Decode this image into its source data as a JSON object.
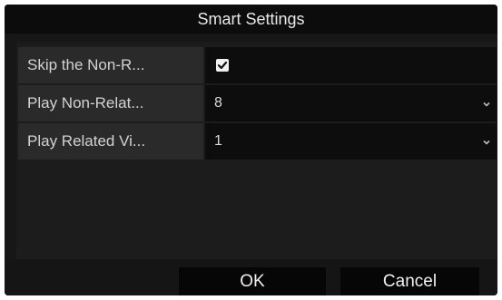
{
  "dialog": {
    "title": "Smart Settings"
  },
  "settings": [
    {
      "label": "Skip the Non-R...",
      "control": "checkbox",
      "checked": true
    },
    {
      "label": "Play Non-Relat...",
      "control": "select",
      "value": "8"
    },
    {
      "label": "Play Related Vi...",
      "control": "select",
      "value": "1"
    }
  ],
  "buttons": {
    "ok_label": "OK",
    "cancel_label": "Cancel"
  },
  "icons": {
    "checkbox": "checkmark-icon",
    "dropdown": "chevron-down-icon"
  },
  "colors": {
    "dialog_background": "#171717",
    "title_bar": "#0c0c0c",
    "label_cell": "#2a2a2a",
    "value_cell": "#0d0d0d",
    "text": "#d2d2d2"
  }
}
